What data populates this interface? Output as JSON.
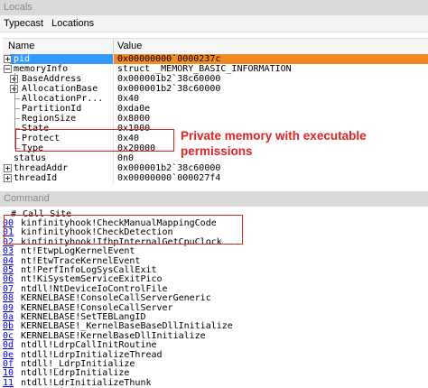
{
  "locals_panel": {
    "title": "Locals",
    "menu": [
      "Typecast",
      "Locations"
    ],
    "columns": {
      "name": "Name",
      "value": "Value"
    },
    "rows": [
      {
        "name": "pid",
        "value": "0x00000000`0000237c",
        "expander": "plus",
        "selected": true
      },
      {
        "name": "memoryInfo",
        "value": "struct _MEMORY_BASIC_INFORMATION",
        "expander": "minus"
      },
      {
        "name": "BaseAddress",
        "value": "0x000001b2`38c60000",
        "expander": "plus"
      },
      {
        "name": "AllocationBase",
        "value": "0x000001b2`38c60000",
        "expander": "plus"
      },
      {
        "name": "AllocationPr...",
        "value": "0x40",
        "expander": "none"
      },
      {
        "name": "PartitionId",
        "value": "0xda0e",
        "expander": "none"
      },
      {
        "name": "RegionSize",
        "value": "0x8000",
        "expander": "none"
      },
      {
        "name": "State",
        "value": "0x1000",
        "expander": "none"
      },
      {
        "name": "Protect",
        "value": "0x40",
        "expander": "none"
      },
      {
        "name": "Type",
        "value": "0x20000",
        "expander": "none"
      },
      {
        "name": "status",
        "value": "0n0",
        "expander": "none"
      },
      {
        "name": "threadAddr",
        "value": "0x000001b2`38c60000",
        "expander": "plus"
      },
      {
        "name": "threadId",
        "value": "0x00000000`000027f4",
        "expander": "plus"
      }
    ],
    "annotation": "Private memory with executable permissions",
    "highlight_color": "#e02424",
    "selection_color": "#3399ff",
    "value_highlight_color": "#f28a24"
  },
  "command_panel": {
    "title": "Command",
    "header": {
      "index": "#",
      "site": "Call Site"
    },
    "frames": [
      {
        "index": "00",
        "site": "kinfinityhook!CheckManualMappingCode"
      },
      {
        "index": "01",
        "site": "kinfinityhook!CheckDetection"
      },
      {
        "index": "02",
        "site": "kinfinityhook!IfhpInternalGetCpuClock"
      },
      {
        "index": "03",
        "site": "nt!EtwpLogKernelEvent"
      },
      {
        "index": "04",
        "site": "nt!EtwTraceKernelEvent"
      },
      {
        "index": "05",
        "site": "nt!PerfInfoLogSysCallExit"
      },
      {
        "index": "06",
        "site": "nt!KiSystemServiceExitPico"
      },
      {
        "index": "07",
        "site": "ntdll!NtDeviceIoControlFile"
      },
      {
        "index": "08",
        "site": "KERNELBASE!ConsoleCallServerGeneric"
      },
      {
        "index": "09",
        "site": "KERNELBASE!ConsoleCallServer"
      },
      {
        "index": "0a",
        "site": "KERNELBASE!SetTEBLangID"
      },
      {
        "index": "0b",
        "site": "KERNELBASE!_KernelBaseBaseDllInitialize"
      },
      {
        "index": "0c",
        "site": "KERNELBASE!KernelBaseDllInitialize"
      },
      {
        "index": "0d",
        "site": "ntdll!LdrpCallInitRoutine"
      },
      {
        "index": "0e",
        "site": "ntdll!LdrpInitializeThread"
      },
      {
        "index": "0f",
        "site": "ntdll!_LdrpInitialize"
      },
      {
        "index": "10",
        "site": "ntdll!LdrpInitialize"
      },
      {
        "index": "11",
        "site": "ntdll!LdrInitializeThunk"
      }
    ]
  }
}
